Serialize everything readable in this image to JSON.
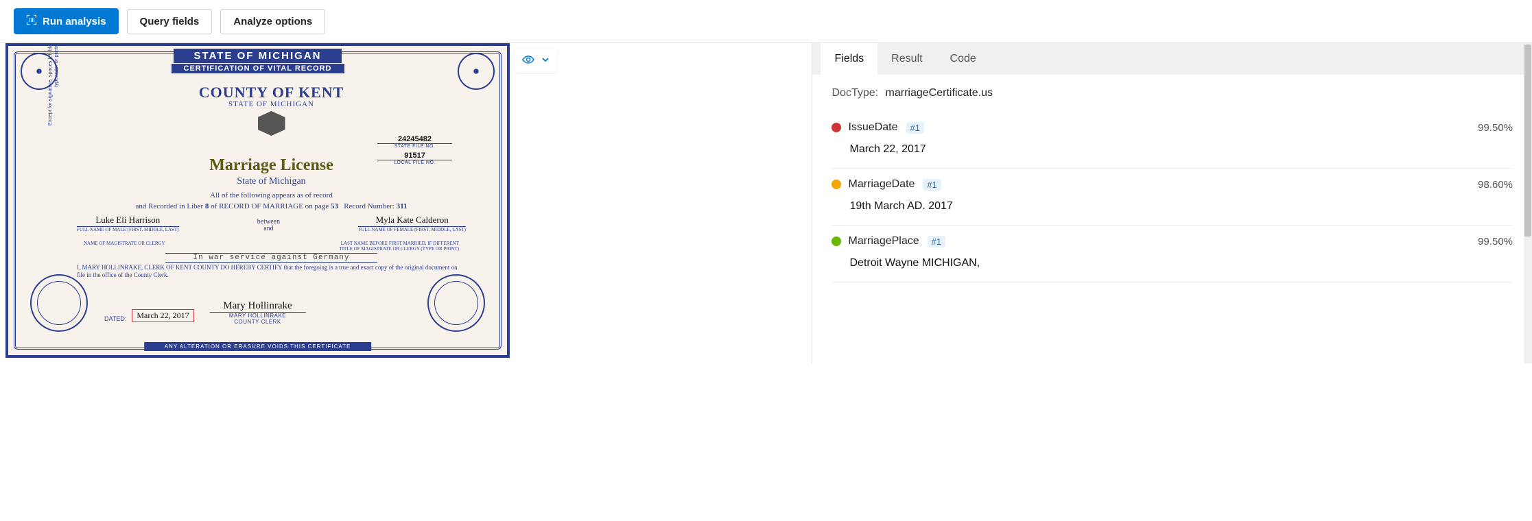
{
  "toolbar": {
    "run_label": "Run analysis",
    "query_label": "Query fields",
    "analyze_label": "Analyze options"
  },
  "doc": {
    "top_banner": "STATE OF MICHIGAN",
    "sub_banner": "CERTIFICATION OF VITAL RECORD",
    "county_title": "COUNTY OF KENT",
    "county_sub": "STATE OF MICHIGAN",
    "doc_title": "Marriage License",
    "som": "State of Michigan",
    "appears": "All of the following appears as of record",
    "rec_line_a": "and Recorded in Liber",
    "rec_liber": "8",
    "rec_line_b": "of RECORD OF MARRIAGE on page",
    "rec_page": "53",
    "rec_line_c": "Record Number:",
    "rec_num": "311",
    "state_file_no": "24245482",
    "state_file_lbl": "STATE FILE NO.",
    "local_file_no": "91517",
    "local_file_lbl": "LOCAL FILE NO.",
    "male_name": "Luke Eli Harrison",
    "male_lbl": "FULL NAME OF MALE (FIRST, MIDDLE, LAST)",
    "between_top": "between",
    "between_bot": "and",
    "female_name": "Myla Kate Calderon",
    "female_lbl": "FULL NAME OF FEMALE (FIRST, MIDDLE, LAST)",
    "mag_left": "NAME OF MAGISTRATE OR CLERGY",
    "mag_right_a": "LAST NAME BEFORE FIRST MARRIED, IF DIFFERENT",
    "mag_right_b": "TITLE OF MAGISTRATE OR CLERGY (TYPE OR PRINT)",
    "svc_text": "In war service against Germany",
    "certify": "I, MARY HOLLINRAKE, CLERK OF KENT COUNTY DO HEREBY CERTIFY that the foregoing is a true and exact copy of the original document on file in the office of the County Clerk.",
    "sig_script": "Mary Hollinrake",
    "sig_name": "MARY HOLLINRAKE",
    "sig_title": "COUNTY CLERK",
    "dated_lbl": "DATED:",
    "dated_val": "March 22, 2017",
    "bottom_banner": "ANY ALTERATION OR ERASURE VOIDS THIS CERTIFICATE",
    "vert_note": "Except for signature, spaces left blank must be completed by typewriter or printed legibly"
  },
  "tabs": {
    "fields": "Fields",
    "result": "Result",
    "code": "Code"
  },
  "doctype": {
    "label": "DocType:",
    "value": "marriageCertificate.us"
  },
  "fields": [
    {
      "color": "#d13438",
      "name": "IssueDate",
      "idx": "#1",
      "conf": "99.50%",
      "value": "March 22, 2017"
    },
    {
      "color": "#f2a600",
      "name": "MarriageDate",
      "idx": "#1",
      "conf": "98.60%",
      "value": "19th March AD. 2017"
    },
    {
      "color": "#6bb700",
      "name": "MarriagePlace",
      "idx": "#1",
      "conf": "99.50%",
      "value": "Detroit Wayne MICHIGAN,"
    }
  ]
}
